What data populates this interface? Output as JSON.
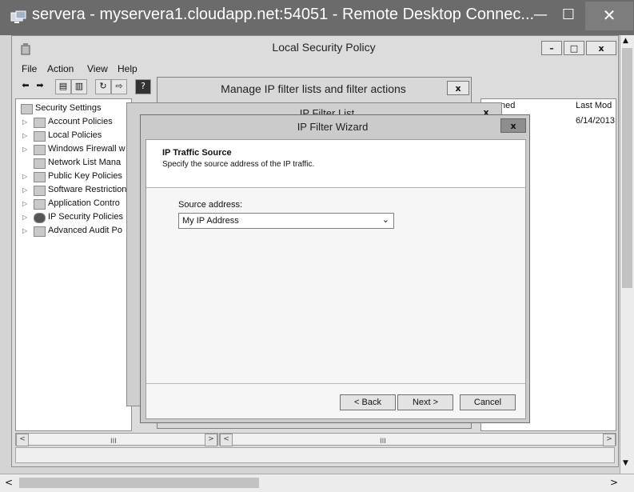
{
  "rdp": {
    "title": "servera - myservera1.cloudapp.net:54051 - Remote Desktop Connec...",
    "min_label": "—",
    "max_label": "☐",
    "close_label": "✕"
  },
  "lsp": {
    "title": "Local Security Policy",
    "min_label": "–",
    "max_label": "□",
    "close_label": "x",
    "menu": [
      "File",
      "Action",
      "View",
      "Help"
    ],
    "tree": [
      {
        "label": "Security Settings",
        "arrow": ""
      },
      {
        "label": "Account Policies",
        "arrow": "▷"
      },
      {
        "label": "Local Policies",
        "arrow": "▷"
      },
      {
        "label": "Windows Firewall w",
        "arrow": "▷"
      },
      {
        "label": "Network List Mana",
        "arrow": ""
      },
      {
        "label": "Public Key Policies",
        "arrow": "▷"
      },
      {
        "label": "Software Restriction",
        "arrow": "▷"
      },
      {
        "label": "Application Contro",
        "arrow": "▷"
      },
      {
        "label": "IP Security Policies",
        "arrow": "▷"
      },
      {
        "label": "Advanced Audit Po",
        "arrow": "▷"
      }
    ],
    "list_columns": [
      "ned",
      "Last Mod"
    ],
    "list_first_value": "6/14/2013",
    "scroll_thumb": "III"
  },
  "manage_dialog": {
    "title": "Manage IP filter lists and filter actions",
    "close_label": "x"
  },
  "filter_list_dialog": {
    "title": "IP Filter List",
    "close_label": "x"
  },
  "wizard": {
    "title": "IP Filter Wizard",
    "close_label": "x",
    "heading": "IP Traffic Source",
    "subheading": "Specify the source address of the IP traffic.",
    "source_label": "Source address:",
    "source_value": "My IP Address",
    "back_label": "< Back",
    "next_label": "Next >",
    "cancel_label": "Cancel"
  }
}
